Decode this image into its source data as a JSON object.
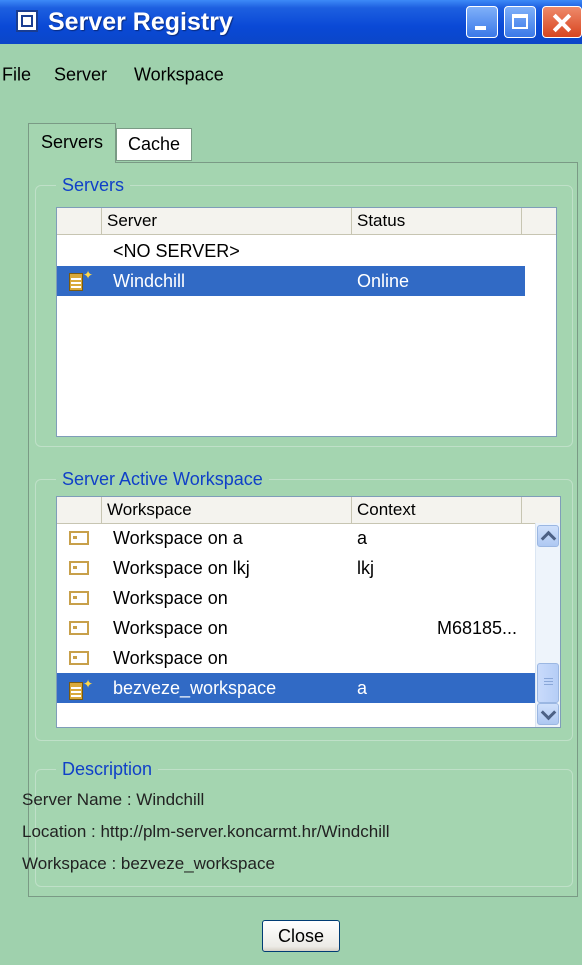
{
  "window": {
    "title": "Server Registry"
  },
  "menu": {
    "items": [
      "File",
      "Server",
      "Workspace"
    ]
  },
  "tabs": [
    {
      "label": "Servers",
      "active": true
    },
    {
      "label": "Cache",
      "active": false
    }
  ],
  "servers_group": {
    "legend": "Servers",
    "columns": [
      "Server",
      "Status"
    ],
    "rows": [
      {
        "name": "<NO SERVER>",
        "status": "",
        "icon": null,
        "selected": false
      },
      {
        "name": "Windchill",
        "status": "Online",
        "icon": "server-icon",
        "selected": true
      }
    ]
  },
  "workspace_group": {
    "legend": "Server Active Workspace",
    "columns": [
      "Workspace",
      "Context"
    ],
    "rows": [
      {
        "name": "Workspace on a",
        "context": "a",
        "selected": false,
        "icon": "workspace-icon"
      },
      {
        "name": "Workspace on lkj",
        "context": "lkj",
        "selected": false,
        "icon": "workspace-icon"
      },
      {
        "name": "Workspace on",
        "context": "",
        "selected": false,
        "icon": "workspace-icon"
      },
      {
        "name": "Workspace on",
        "context": "M68185...",
        "selected": false,
        "icon": "workspace-icon"
      },
      {
        "name": "Workspace on",
        "context": "",
        "selected": false,
        "icon": "workspace-icon"
      },
      {
        "name": "bezveze_workspace",
        "context": "a",
        "selected": true,
        "icon": "active-workspace-icon"
      }
    ]
  },
  "description": {
    "legend": "Description",
    "lines": [
      "Server Name : Windchill",
      "Location : http://plm-server.koncarmt.hr/Windchill",
      "Workspace : bezveze_workspace"
    ]
  },
  "buttons": {
    "close_label": "Close"
  },
  "colors": {
    "background": "#9fd1ad",
    "selection": "#316ac5",
    "legend_text": "#1040c8",
    "titlebar": "#0a49d6"
  }
}
